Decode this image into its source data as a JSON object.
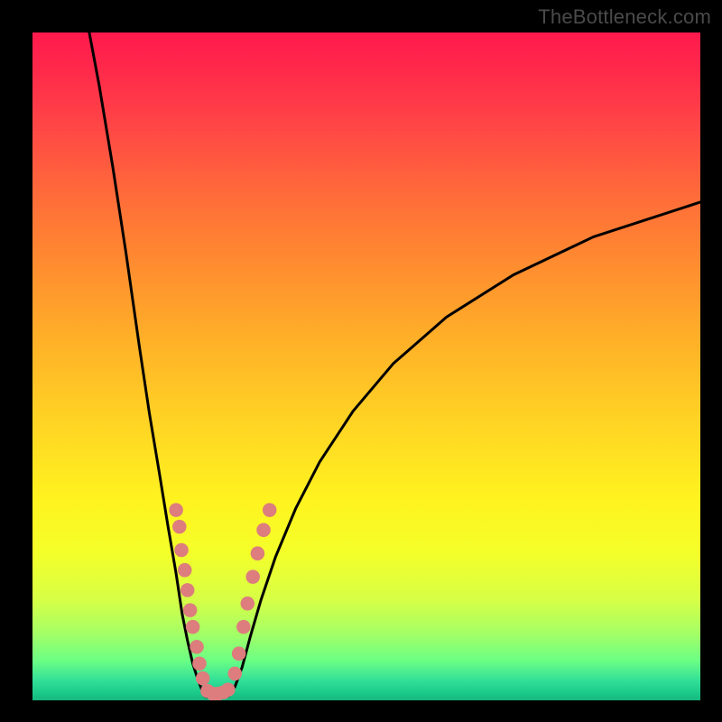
{
  "watermark": "TheBottleneck.com",
  "colors": {
    "curve_stroke": "#000000",
    "marker_fill": "#dd7d7d",
    "marker_stroke": "#dd7d7d",
    "frame_bg": "#000000"
  },
  "chart_data": {
    "type": "line",
    "title": "",
    "xlabel": "",
    "ylabel": "",
    "xlim": [
      0,
      100
    ],
    "ylim": [
      0,
      100
    ],
    "grid": false,
    "legend": false,
    "annotations": [
      "TheBottleneck.com"
    ],
    "series": [
      {
        "name": "left-curve",
        "x": [
          8.5,
          10,
          12,
          14,
          16,
          17.5,
          19,
          20.3,
          21.5,
          22.4,
          23.2,
          24,
          24.8,
          25.4,
          25.8
        ],
        "y": [
          100,
          92,
          80,
          67,
          53,
          43,
          34,
          26,
          19,
          13,
          9,
          5.5,
          3,
          1.5,
          0.6
        ]
      },
      {
        "name": "valley-floor",
        "x": [
          25.8,
          26.6,
          27.6,
          28.6,
          29.4
        ],
        "y": [
          0.6,
          0.4,
          0.4,
          0.5,
          0.7
        ]
      },
      {
        "name": "right-curve",
        "x": [
          29.4,
          30.3,
          31.4,
          32.6,
          34.2,
          36.4,
          39.4,
          43,
          48,
          54,
          62,
          72,
          84,
          100
        ],
        "y": [
          0.7,
          2,
          5,
          9.5,
          15,
          21.5,
          28.7,
          35.7,
          43.3,
          50.4,
          57.4,
          63.7,
          69.4,
          74.6
        ]
      }
    ],
    "markers": {
      "left_branch": [
        {
          "x": 21.5,
          "y": 28.5
        },
        {
          "x": 22.0,
          "y": 26.0
        },
        {
          "x": 22.3,
          "y": 22.5
        },
        {
          "x": 22.8,
          "y": 19.5
        },
        {
          "x": 23.2,
          "y": 16.5
        },
        {
          "x": 23.6,
          "y": 13.5
        },
        {
          "x": 24.0,
          "y": 11.0
        },
        {
          "x": 24.6,
          "y": 8.0
        },
        {
          "x": 25.0,
          "y": 5.5
        },
        {
          "x": 25.5,
          "y": 3.3
        }
      ],
      "valley": [
        {
          "x": 26.2,
          "y": 1.4
        },
        {
          "x": 27.0,
          "y": 1.0
        },
        {
          "x": 27.8,
          "y": 1.0
        },
        {
          "x": 28.6,
          "y": 1.2
        },
        {
          "x": 29.3,
          "y": 1.6
        }
      ],
      "right_branch": [
        {
          "x": 30.3,
          "y": 4.0
        },
        {
          "x": 30.9,
          "y": 7.0
        },
        {
          "x": 31.6,
          "y": 11.0
        },
        {
          "x": 32.2,
          "y": 14.5
        },
        {
          "x": 33.0,
          "y": 18.5
        },
        {
          "x": 33.7,
          "y": 22.0
        },
        {
          "x": 34.6,
          "y": 25.5
        },
        {
          "x": 35.5,
          "y": 28.5
        }
      ]
    },
    "marker_radius": 1.05
  }
}
